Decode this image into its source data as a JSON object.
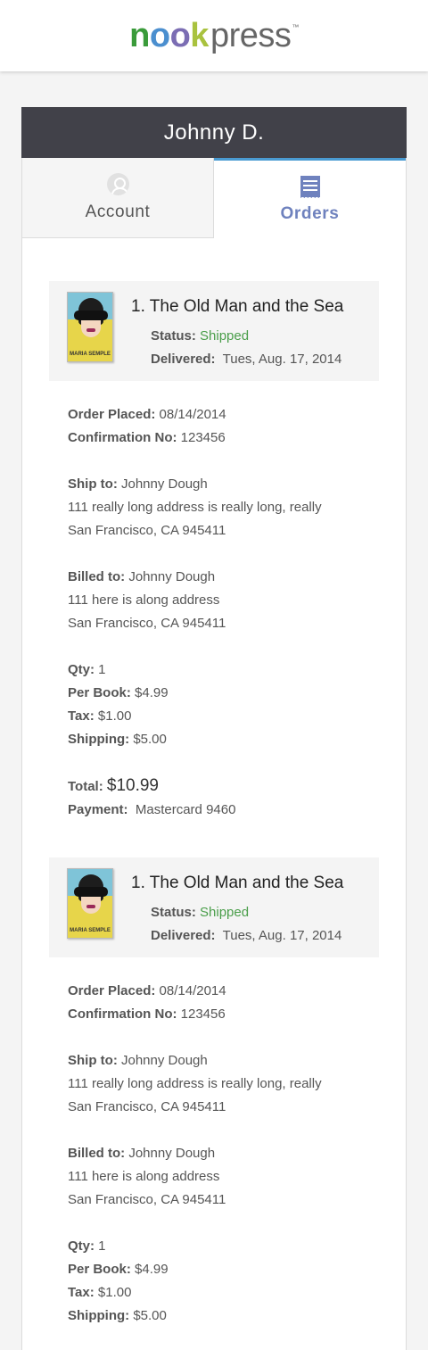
{
  "brand": {
    "logo_nook_parts": [
      "n",
      "o",
      "o",
      "k"
    ],
    "logo_press": "press",
    "logo_tm": "™",
    "colors": {
      "n": "#3a9b3a",
      "o1": "#4b8fcf",
      "o2": "#7b6db3",
      "k": "#a9c23f",
      "accent": "#4a9bd2",
      "tab_active": "#6f82be",
      "shipped": "#4a9e4a"
    }
  },
  "profile": {
    "name": "Johnny D."
  },
  "tabs": [
    {
      "label": "Account",
      "icon": "user-icon",
      "active": false
    },
    {
      "label": "Orders",
      "icon": "receipt-icon",
      "active": true
    }
  ],
  "labels": {
    "status": "Status:",
    "delivered": "Delivered:",
    "order_placed": "Order Placed:",
    "confirmation": "Confirmation No:",
    "ship_to": "Ship to:",
    "billed_to": "Billed to:",
    "qty": "Qty:",
    "per_book": "Per Book:",
    "tax": "Tax:",
    "shipping": "Shipping:",
    "total": "Total:",
    "payment": "Payment:"
  },
  "orders": [
    {
      "title": "1. The Old Man and the Sea",
      "cover_author": "MARIA SEMPLE",
      "status": "Shipped",
      "delivered": "Tues, Aug. 17, 2014",
      "order_placed": "08/14/2014",
      "confirmation": "123456",
      "ship_to_name": "Johnny Dough",
      "ship_to_line1": "111 really long address is really long, really",
      "ship_to_line2": "San Francisco, CA 945411",
      "billed_to_name": "Johnny Dough",
      "billed_to_line1": "111 here is along address",
      "billed_to_line2": "San Francisco, CA 945411",
      "qty": "1",
      "per_book": "$4.99",
      "tax": "$1.00",
      "shipping": "$5.00",
      "total": "$10.99",
      "payment": "Mastercard 9460"
    },
    {
      "title": "1. The Old Man and the Sea",
      "cover_author": "MARIA SEMPLE",
      "status": "Shipped",
      "delivered": "Tues, Aug. 17, 2014",
      "order_placed": "08/14/2014",
      "confirmation": "123456",
      "ship_to_name": "Johnny Dough",
      "ship_to_line1": "111 really long address is really long, really",
      "ship_to_line2": "San Francisco, CA 945411",
      "billed_to_name": "Johnny Dough",
      "billed_to_line1": "111 here is along address",
      "billed_to_line2": "San Francisco, CA 945411",
      "qty": "1",
      "per_book": "$4.99",
      "tax": "$1.00",
      "shipping": "$5.00"
    }
  ]
}
